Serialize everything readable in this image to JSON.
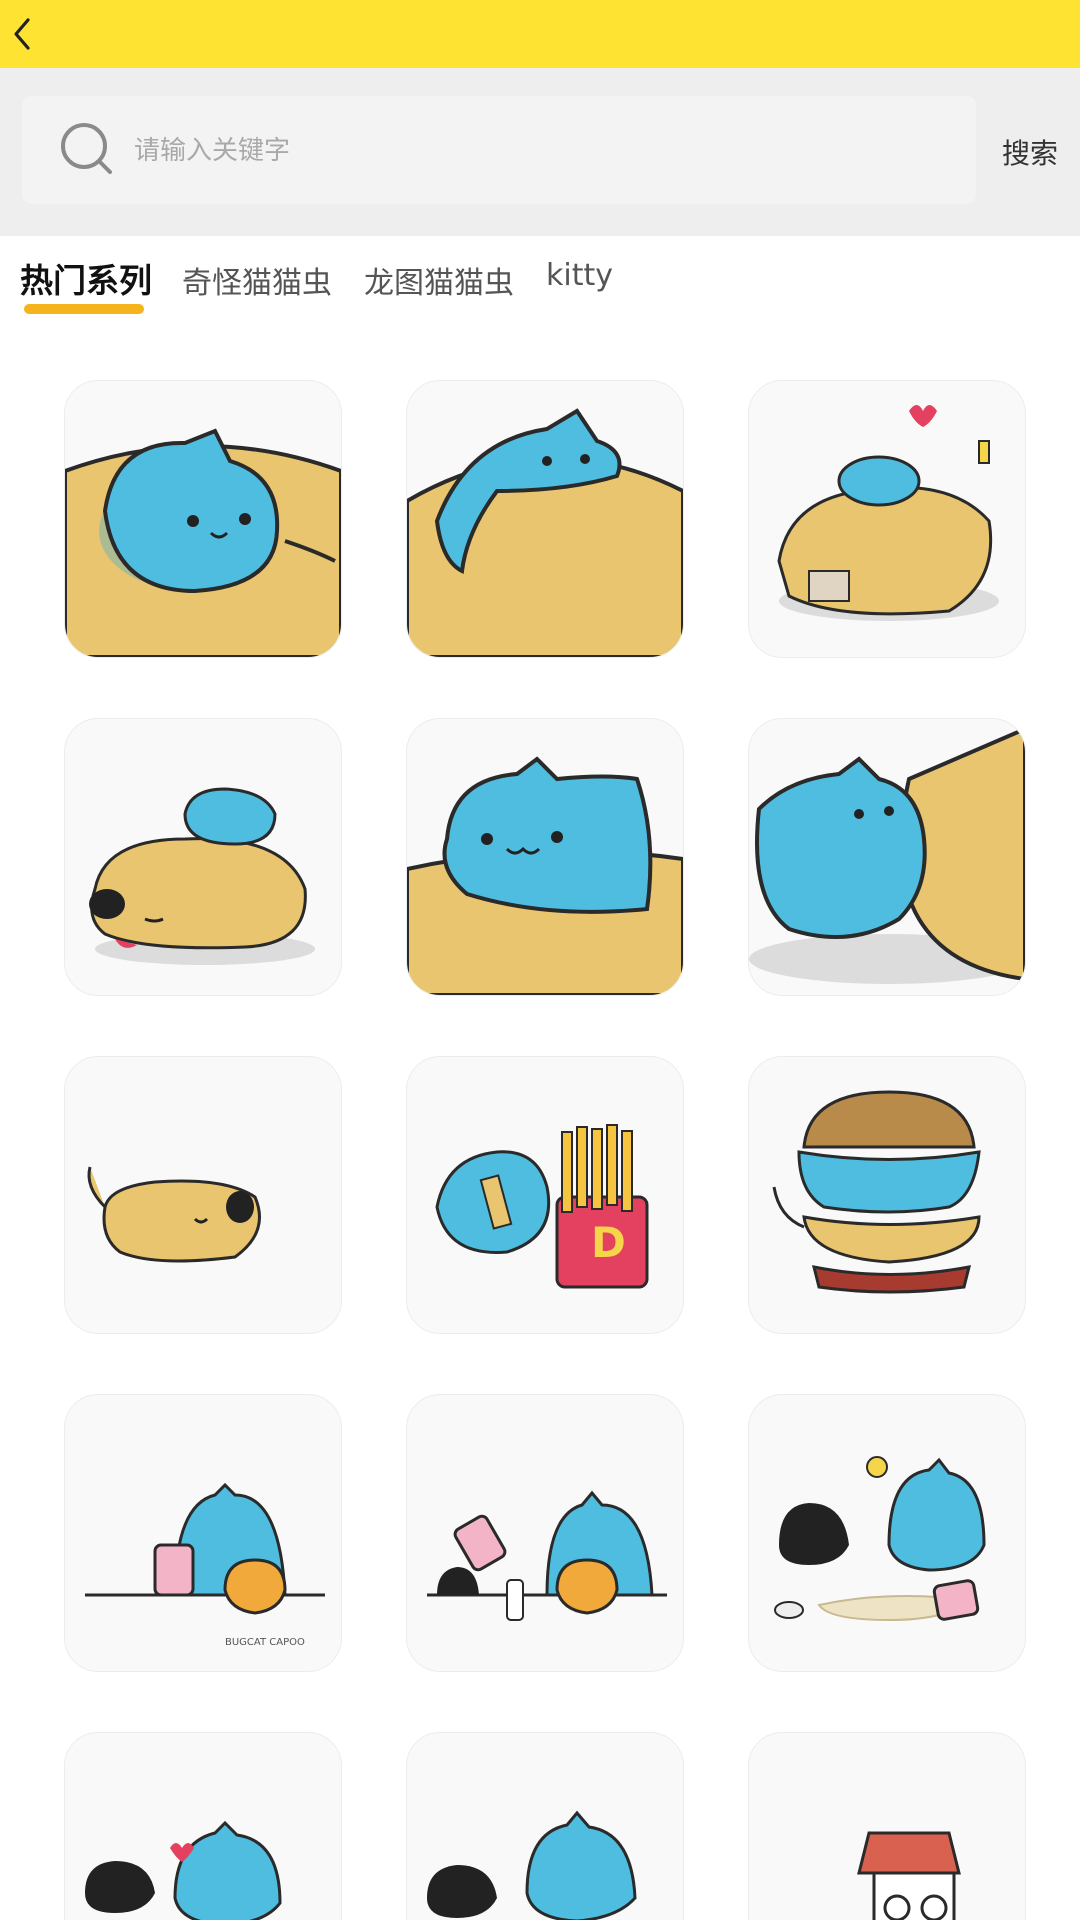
{
  "header": {
    "back_icon": "chevron-left-icon"
  },
  "search": {
    "placeholder": "请输入关键字",
    "value": "",
    "button_label": "搜索",
    "icon": "search-icon"
  },
  "tabs": [
    {
      "label": "热门系列",
      "active": true
    },
    {
      "label": "奇怪猫猫虫",
      "active": false
    },
    {
      "label": "龙图猫猫虫",
      "active": false
    },
    {
      "label": "kitty",
      "active": false
    }
  ],
  "colors": {
    "accent": "#ffe332",
    "tab_indicator": "#f5b31c",
    "cat_blue": "#4fbde0",
    "dog_tan": "#e9c56f"
  },
  "stickers": [
    {
      "name": "cat-lying-on-dog-closeup"
    },
    {
      "name": "cat-sliding-over-dog"
    },
    {
      "name": "cat-on-dog-with-lamp-and-heart"
    },
    {
      "name": "cat-sleeping-on-dog"
    },
    {
      "name": "cat-hugging-dog-paw"
    },
    {
      "name": "cat-pushing-dog"
    },
    {
      "name": "dog-walking"
    },
    {
      "name": "cat-eating-fries"
    },
    {
      "name": "cat-dog-burger-stack"
    },
    {
      "name": "cat-with-jar-and-kettle"
    },
    {
      "name": "cat-jar-tipping-kettle"
    },
    {
      "name": "cats-spilled-jar-idea"
    },
    {
      "name": "cats-with-heart-spill"
    },
    {
      "name": "cats-happy-spill"
    },
    {
      "name": "house-with-rainbow"
    }
  ],
  "watermark_text": "BUGCAT CAPOO"
}
